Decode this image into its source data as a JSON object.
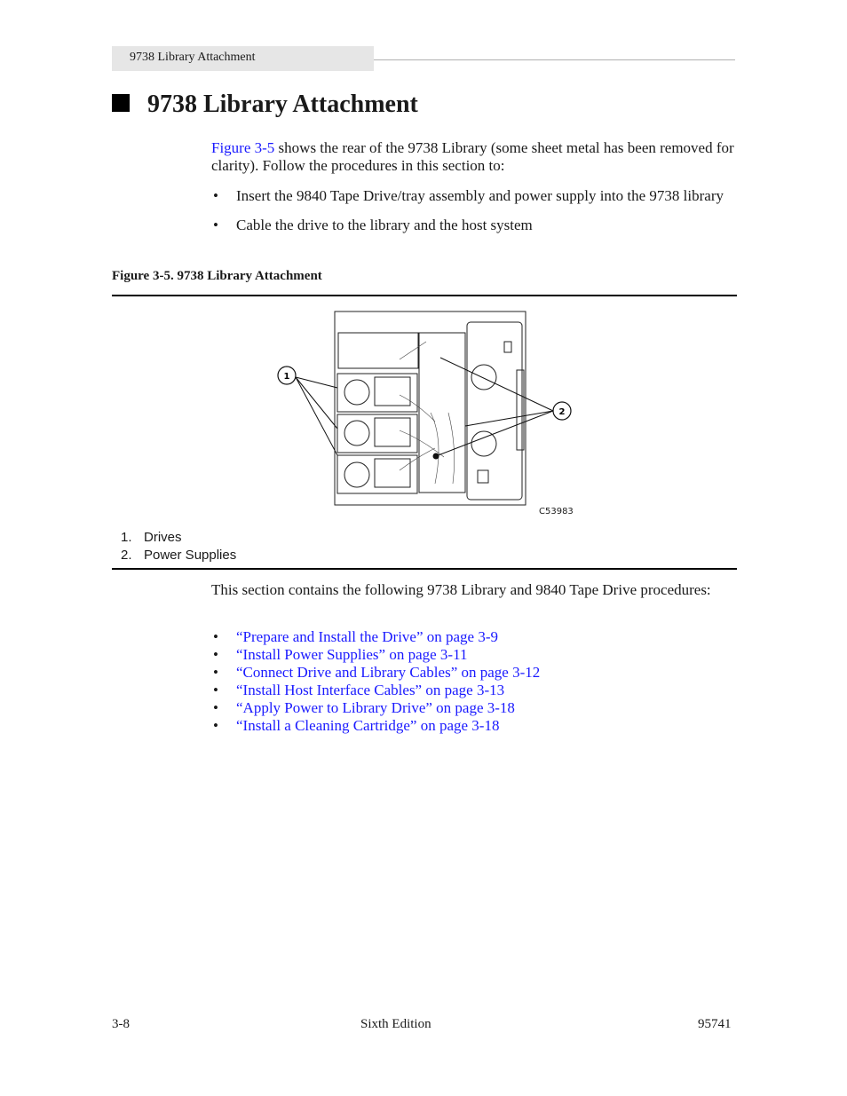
{
  "running_head": "9738 Library Attachment",
  "page_title": "9738 Library Attachment",
  "intro": {
    "link": "Figure 3-5",
    "text": " shows the rear of the 9738 Library (some sheet metal has been removed for clarity). Follow the procedures in this section to:"
  },
  "tasks": [
    "Insert the 9840 Tape Drive/tray assembly and power supply into the 9738 library",
    "Cable the drive to the library and the host system"
  ],
  "figure": {
    "caption": "Figure 3-5. 9738 Library Attachment",
    "id": "C53983",
    "callouts": [
      "1",
      "2"
    ],
    "legend": [
      {
        "num": "1.",
        "label": "Drives"
      },
      {
        "num": "2.",
        "label": "Power Supplies"
      }
    ]
  },
  "procedures_intro": "This section contains the following 9738 Library and 9840 Tape Drive procedures:",
  "procedures": [
    "“Prepare and Install the Drive” on page 3-9",
    "“Install Power Supplies” on page 3-11",
    "“Connect Drive and Library Cables” on page 3-12",
    "“Install Host Interface Cables” on page 3-13",
    "“Apply Power to Library Drive” on page 3-18",
    "“Install a Cleaning Cartridge” on page 3-18"
  ],
  "footer": {
    "page": "3-8",
    "edition": "Sixth Edition",
    "doc_number": "95741"
  }
}
